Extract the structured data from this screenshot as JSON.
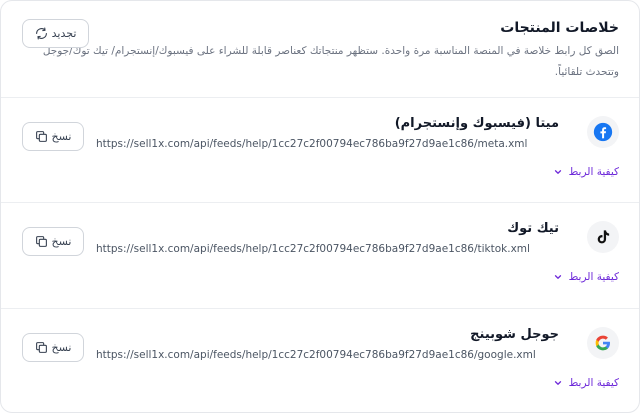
{
  "header": {
    "title": "خلاصات المنتجات",
    "description": "الصق كل رابط خلاصة في المنصة المناسبة مرة واحدة. ستظهر منتجاتك كعناصر قابلة للشراء على فيسبوك/إنستجرام/ تيك توك/جوجل وتتحدث تلقائياً.",
    "refresh_label": "تجديد"
  },
  "feeds": [
    {
      "platform": "ميتا (فيسبوك وإنستجرام)",
      "url": "https://sell1x.com/api/feeds/help/1cc27c2f00794ec786ba9f27d9ae1c86/meta.xml",
      "copy_label": "نسخ",
      "how_label": "كيفية الربط",
      "icon": "facebook-icon"
    },
    {
      "platform": "تيك توك",
      "url": "https://sell1x.com/api/feeds/help/1cc27c2f00794ec786ba9f27d9ae1c86/tiktok.xml",
      "copy_label": "نسخ",
      "how_label": "كيفية الربط",
      "icon": "tiktok-icon"
    },
    {
      "platform": "جوجل شوبينج",
      "url": "https://sell1x.com/api/feeds/help/1cc27c2f00794ec786ba9f27d9ae1c86/google.xml",
      "copy_label": "نسخ",
      "how_label": "كيفية الربط",
      "icon": "google-icon"
    }
  ],
  "colors": {
    "accent": "#6d28d9",
    "facebook": "#1877F2",
    "border": "#e5e7eb"
  }
}
